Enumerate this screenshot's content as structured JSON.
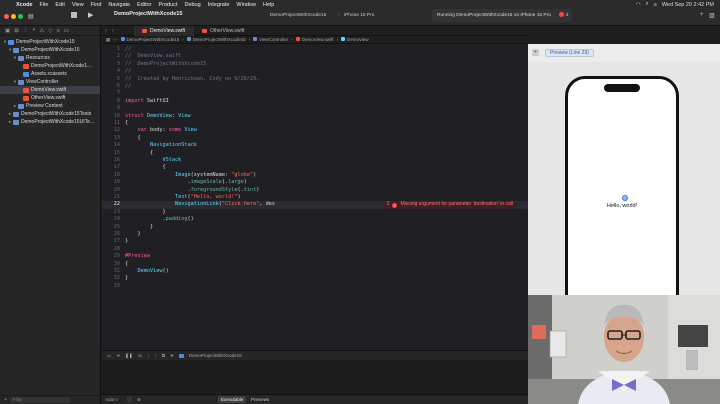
{
  "menubar": {
    "app": "Xcode",
    "items": [
      "File",
      "Edit",
      "View",
      "Find",
      "Navigate",
      "Editor",
      "Product",
      "Debug",
      "Integrate",
      "Window",
      "Help"
    ],
    "clock": "Wed Sep 20  2:42 PM"
  },
  "toolbar": {
    "project": "DemoProjectWithXcode15",
    "scheme": "DemoProjectWithXcode15",
    "device": "iPhone 15 Pro",
    "status": "Running DemoProjectWithXcode15 on iPhone 15 Pro",
    "error_count": "2"
  },
  "navigator": {
    "items": [
      {
        "label": "DemoProjectWithXcode15",
        "icon": "project-icon",
        "indent": 0
      },
      {
        "label": "DemoProjectWithXcode15",
        "icon": "folder-icon",
        "indent": 1
      },
      {
        "label": "Resources",
        "icon": "folder-icon",
        "indent": 2
      },
      {
        "label": "DemoProjectWithXcode1...",
        "icon": "swift-file-icon",
        "indent": 3
      },
      {
        "label": "Assets.xcassets",
        "icon": "asset-catalog-icon",
        "indent": 3
      },
      {
        "label": "ViewController",
        "icon": "folder-icon",
        "indent": 2
      },
      {
        "label": "DemoView.swift",
        "icon": "swift-file-icon",
        "indent": 3,
        "selected": true
      },
      {
        "label": "OtherView.swift",
        "icon": "swift-file-icon",
        "indent": 3
      },
      {
        "label": "Preview Content",
        "icon": "folder-icon",
        "indent": 2
      },
      {
        "label": "DemoProjectWithXcode15Tests",
        "icon": "folder-icon",
        "indent": 1
      },
      {
        "label": "DemoProjectWithXcode15UITe...",
        "icon": "folder-icon",
        "indent": 1
      }
    ],
    "filter_placeholder": "Filter"
  },
  "tabs": [
    {
      "label": "DemoView.swift",
      "active": true
    },
    {
      "label": "OtherView.swift",
      "active": false
    }
  ],
  "jumpbar": [
    "DemoProjectWithXcode15",
    "DemoProjectWithXcode15",
    "ViewController",
    "DemoView.swift",
    "DemoView"
  ],
  "editor": {
    "current_line": 22,
    "lines": [
      {
        "n": "1",
        "parts": [
          [
            "cmt",
            "//"
          ]
        ]
      },
      {
        "n": "2",
        "parts": [
          [
            "cmt",
            "//  DemoView.swift"
          ]
        ]
      },
      {
        "n": "3",
        "parts": [
          [
            "cmt",
            "//  DemoProjectWithXcode15"
          ]
        ]
      },
      {
        "n": "4",
        "parts": [
          [
            "cmt",
            "//"
          ]
        ]
      },
      {
        "n": "5",
        "parts": [
          [
            "cmt",
            "//  Created by Henrichsen, Cody on 9/20/23."
          ]
        ]
      },
      {
        "n": "6",
        "parts": [
          [
            "cmt",
            "//"
          ]
        ]
      },
      {
        "n": "7",
        "parts": []
      },
      {
        "n": "8",
        "parts": [
          [
            "kw",
            "import"
          ],
          [
            "plain",
            " SwiftUI"
          ]
        ]
      },
      {
        "n": "9",
        "parts": []
      },
      {
        "n": "10",
        "parts": [
          [
            "kw",
            "struct"
          ],
          [
            "plain",
            " "
          ],
          [
            "ty",
            "DemoView"
          ],
          [
            "plain",
            ": "
          ],
          [
            "ty",
            "View"
          ]
        ]
      },
      {
        "n": "11",
        "parts": [
          [
            "plain",
            "{"
          ]
        ]
      },
      {
        "n": "12",
        "parts": [
          [
            "plain",
            "    "
          ],
          [
            "kw",
            "var"
          ],
          [
            "plain",
            " body: "
          ],
          [
            "kw",
            "some"
          ],
          [
            "plain",
            " "
          ],
          [
            "ty",
            "View"
          ]
        ]
      },
      {
        "n": "13",
        "parts": [
          [
            "plain",
            "    {"
          ]
        ]
      },
      {
        "n": "14",
        "parts": [
          [
            "plain",
            "        "
          ],
          [
            "ty",
            "NavigationStack"
          ]
        ]
      },
      {
        "n": "15",
        "parts": [
          [
            "plain",
            "        {"
          ]
        ]
      },
      {
        "n": "16",
        "parts": [
          [
            "plain",
            "            "
          ],
          [
            "ty",
            "VStack"
          ]
        ]
      },
      {
        "n": "17",
        "parts": [
          [
            "plain",
            "            {"
          ]
        ]
      },
      {
        "n": "18",
        "parts": [
          [
            "plain",
            "                "
          ],
          [
            "ty",
            "Image"
          ],
          [
            "plain",
            "(systemName: "
          ],
          [
            "str",
            "\"globe\""
          ],
          [
            "plain",
            ")"
          ]
        ]
      },
      {
        "n": "19",
        "parts": [
          [
            "plain",
            "                    ."
          ],
          [
            "fn",
            "imageScale"
          ],
          [
            "plain",
            "(."
          ],
          [
            "fn",
            "large"
          ],
          [
            "plain",
            ")"
          ]
        ]
      },
      {
        "n": "20",
        "parts": [
          [
            "plain",
            "                    ."
          ],
          [
            "fn",
            "foregroundStyle"
          ],
          [
            "plain",
            "(."
          ],
          [
            "fn",
            "tint"
          ],
          [
            "plain",
            ")"
          ]
        ]
      },
      {
        "n": "21",
        "parts": [
          [
            "plain",
            "                "
          ],
          [
            "ty",
            "Text"
          ],
          [
            "plain",
            "("
          ],
          [
            "str",
            "\"Hello, world!\""
          ],
          [
            "plain",
            ")"
          ]
        ]
      },
      {
        "n": "22",
        "parts": [
          [
            "plain",
            "                "
          ],
          [
            "ty",
            "NavigationLink"
          ],
          [
            "plain",
            "("
          ],
          [
            "str",
            "\"Click here\""
          ],
          [
            "plain",
            ", des"
          ]
        ]
      },
      {
        "n": "23",
        "parts": [
          [
            "plain",
            "            }"
          ]
        ]
      },
      {
        "n": "24",
        "parts": [
          [
            "plain",
            "            ."
          ],
          [
            "fn",
            "padding"
          ],
          [
            "plain",
            "()"
          ]
        ]
      },
      {
        "n": "25",
        "parts": [
          [
            "plain",
            "        }"
          ]
        ]
      },
      {
        "n": "26",
        "parts": [
          [
            "plain",
            "    }"
          ]
        ]
      },
      {
        "n": "27",
        "parts": [
          [
            "plain",
            "}"
          ]
        ]
      },
      {
        "n": "28",
        "parts": []
      },
      {
        "n": "29",
        "parts": [
          [
            "kw",
            "#Preview"
          ]
        ]
      },
      {
        "n": "30",
        "parts": [
          [
            "plain",
            "{"
          ]
        ]
      },
      {
        "n": "31",
        "parts": [
          [
            "plain",
            "    "
          ],
          [
            "ty",
            "DemoView"
          ],
          [
            "plain",
            "()"
          ]
        ]
      },
      {
        "n": "32",
        "parts": [
          [
            "plain",
            "}"
          ]
        ]
      },
      {
        "n": "33",
        "parts": []
      }
    ],
    "error": {
      "count": "2",
      "message": "Missing argument for parameter 'destination' in call"
    }
  },
  "debugbar": {
    "target": "DemoProjectWithXcode15"
  },
  "bottombar": {
    "left": "Auto ◊",
    "executable": "Executable",
    "previews": "Previews"
  },
  "canvas": {
    "preview_label": "Preview (Line 29)",
    "hello_text": "Hello, world!"
  },
  "colors": {
    "keyword": "#fc5fa3",
    "type": "#5dd8ff",
    "string": "#fc6a5d",
    "comment": "#6c7986",
    "error": "#ff4545",
    "accent": "#3a7be0"
  }
}
